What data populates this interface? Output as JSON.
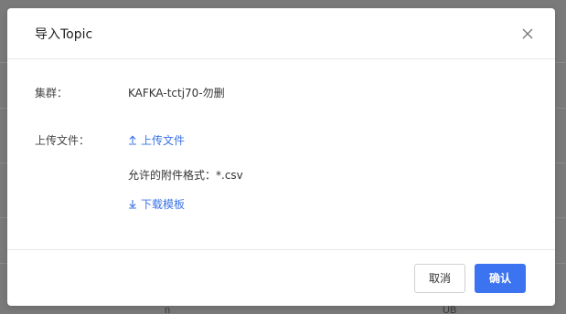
{
  "background": {
    "text_left": "n",
    "text_right": "UB"
  },
  "dialog": {
    "title": "导入Topic",
    "close_icon": "close-icon",
    "cluster": {
      "label": "集群：",
      "value": "KAFKA-tctj70-勿删"
    },
    "upload": {
      "label": "上传文件：",
      "link_label": "上传文件",
      "link_icon": "upload-icon",
      "formats_text": "允许的附件格式：*.csv",
      "download_label": "下载模板",
      "download_icon": "download-icon"
    },
    "footer": {
      "cancel_label": "取消",
      "confirm_label": "确认"
    },
    "colors": {
      "primary": "#3b73f0",
      "link": "#3b73e6"
    }
  }
}
